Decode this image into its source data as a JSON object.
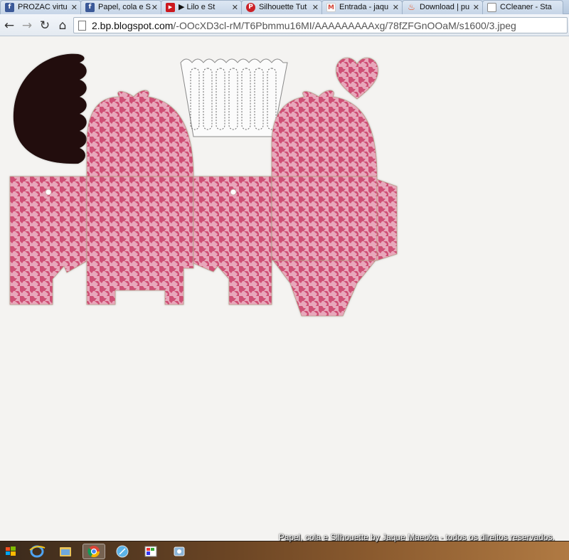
{
  "tabs": [
    {
      "label": "PROZAC virtu",
      "icon": "facebook-icon",
      "color": "#3b5998",
      "glyph": "f"
    },
    {
      "label": "Papel, cola e S",
      "icon": "facebook-icon",
      "color": "#3b5998",
      "glyph": "f"
    },
    {
      "label": "▶ Lilo e St",
      "icon": "youtube-icon",
      "color": "#cc181e",
      "glyph": "▶"
    },
    {
      "label": "Silhouette Tut",
      "icon": "pinterest-icon",
      "color": "#cb2027",
      "glyph": "P"
    },
    {
      "label": "Entrada - jaqu",
      "icon": "gmail-icon",
      "color": "#d44638",
      "glyph": "M"
    },
    {
      "label": "Download | pu",
      "icon": "flame-icon",
      "color": "#e8501e",
      "glyph": "♨"
    },
    {
      "label": "CCleaner - Sta",
      "icon": "page-icon",
      "color": "#ffffff",
      "glyph": ""
    }
  ],
  "toolbar": {
    "back": "←",
    "forward": "→",
    "reload": "↻",
    "home": "⌂",
    "url_host": "2.bp.blogspot.com",
    "url_path": "/-OOcXD3cl-rM/T6Pbmmu16MI/AAAAAAAAAxg/78fZFGnOOaM/s1600/3.jpeg"
  },
  "content": {
    "pattern_base": "#e8a7bb",
    "pattern_dark": "#cf4f74",
    "hair_color": "#231008"
  },
  "taskbar": {
    "watermark": "Papel, cola e Silhouette by Jaque Maeoka - todos os direitos reservados.",
    "apps": [
      "windows-start-icon",
      "ie-icon",
      "explorer-icon",
      "chrome-icon",
      "safari-icon",
      "paint-icon",
      "photos-icon"
    ]
  }
}
